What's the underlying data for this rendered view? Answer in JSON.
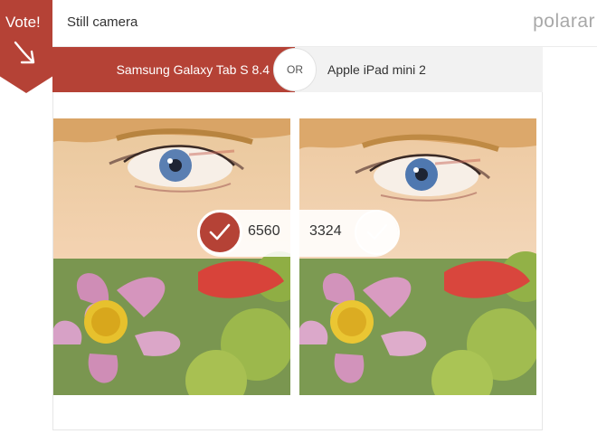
{
  "header": {
    "title": "Still camera",
    "brand": "polarar"
  },
  "ribbon": {
    "label": "Vote!",
    "icon": "arrow-down-right-icon"
  },
  "comparison": {
    "device_a": "Samsung Galaxy Tab S 8.4",
    "separator": "OR",
    "device_b": "Apple iPad mini 2"
  },
  "votes": {
    "left_count": "6560",
    "right_count": "3324",
    "left_icon": "check-icon",
    "right_icon": "check-icon"
  },
  "colors": {
    "accent": "#b54236",
    "bar_background": "#f2f2f2",
    "brand_text": "#a8a8a8"
  }
}
